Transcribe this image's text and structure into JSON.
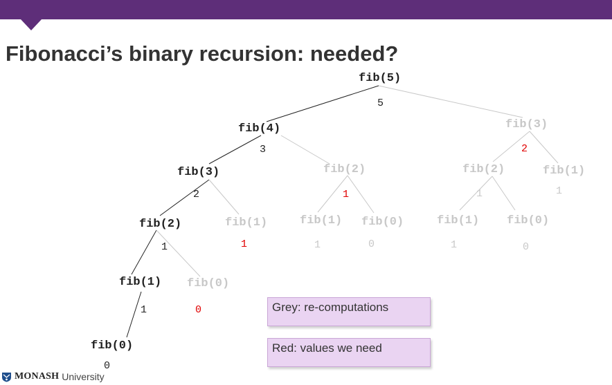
{
  "header": {
    "title": "Fibonacci’s binary recursion: needed?"
  },
  "colors": {
    "banner": "#5e2e79",
    "needed": "#e00000",
    "recomputation": "#c8c8c8",
    "note_fill": "#ead4f2"
  },
  "tree": {
    "nodes": {
      "fib5": {
        "label": "fib(5)",
        "value": "5"
      },
      "fib4": {
        "label": "fib(4)",
        "value": "3"
      },
      "fib3_right": {
        "label": "fib(3)",
        "value": "2"
      },
      "fib3_left": {
        "label": "fib(3)",
        "value": "2"
      },
      "fib2_mid": {
        "label": "fib(2)",
        "value": "1"
      },
      "fib2_right": {
        "label": "fib(2)",
        "value": "1"
      },
      "fib1_right": {
        "label": "fib(1)",
        "value": "1"
      },
      "fib2_left": {
        "label": "fib(2)",
        "value": "1"
      },
      "fib1_a": {
        "label": "fib(1)",
        "value": "1"
      },
      "fib1_b": {
        "label": "fib(1)",
        "value": "1"
      },
      "fib0_b": {
        "label": "fib(0)",
        "value": "0"
      },
      "fib1_c": {
        "label": "fib(1)",
        "value": "1"
      },
      "fib0_c": {
        "label": "fib(0)",
        "value": "0"
      },
      "fib1_left": {
        "label": "fib(1)",
        "value": "1"
      },
      "fib0_a": {
        "label": "fib(0)",
        "value": "0"
      },
      "fib0_left": {
        "label": "fib(0)",
        "value": "0"
      }
    }
  },
  "notes": {
    "grey": "Grey: re-computations",
    "red": "Red: values we need"
  },
  "footer": {
    "logo_brand": "MONASH",
    "logo_sub": "University"
  }
}
